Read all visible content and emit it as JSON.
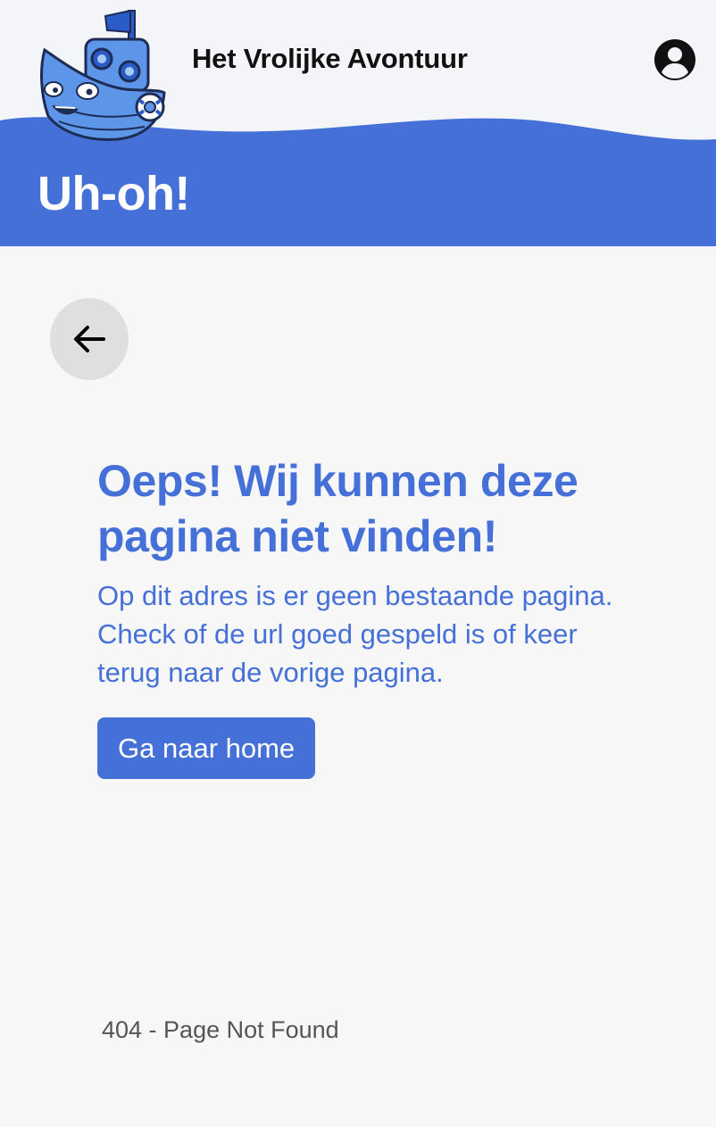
{
  "header": {
    "app_title": "Het Vrolijke Avontuur",
    "logo_icon": "boat-mascot-icon",
    "account_icon": "account-circle-icon"
  },
  "hero": {
    "title": "Uh-oh!"
  },
  "nav": {
    "back_icon": "arrow-left-icon"
  },
  "error": {
    "title": "Oeps! Wij kunnen deze pagina niet vinden!",
    "description": "Op dit adres is er geen bestaande pagina. Check of de url goed gespeld is of keer terug naar de vorige pagina.",
    "home_button_label": "Ga naar home"
  },
  "footer": {
    "status_text": "404 - Page Not Found"
  },
  "colors": {
    "primary": "#4570d8",
    "header_bg": "#f4f5f8",
    "page_bg": "#f7f7f8",
    "back_button_bg": "#dfdfe0",
    "text_dark": "#111111",
    "text_muted": "#555555"
  }
}
